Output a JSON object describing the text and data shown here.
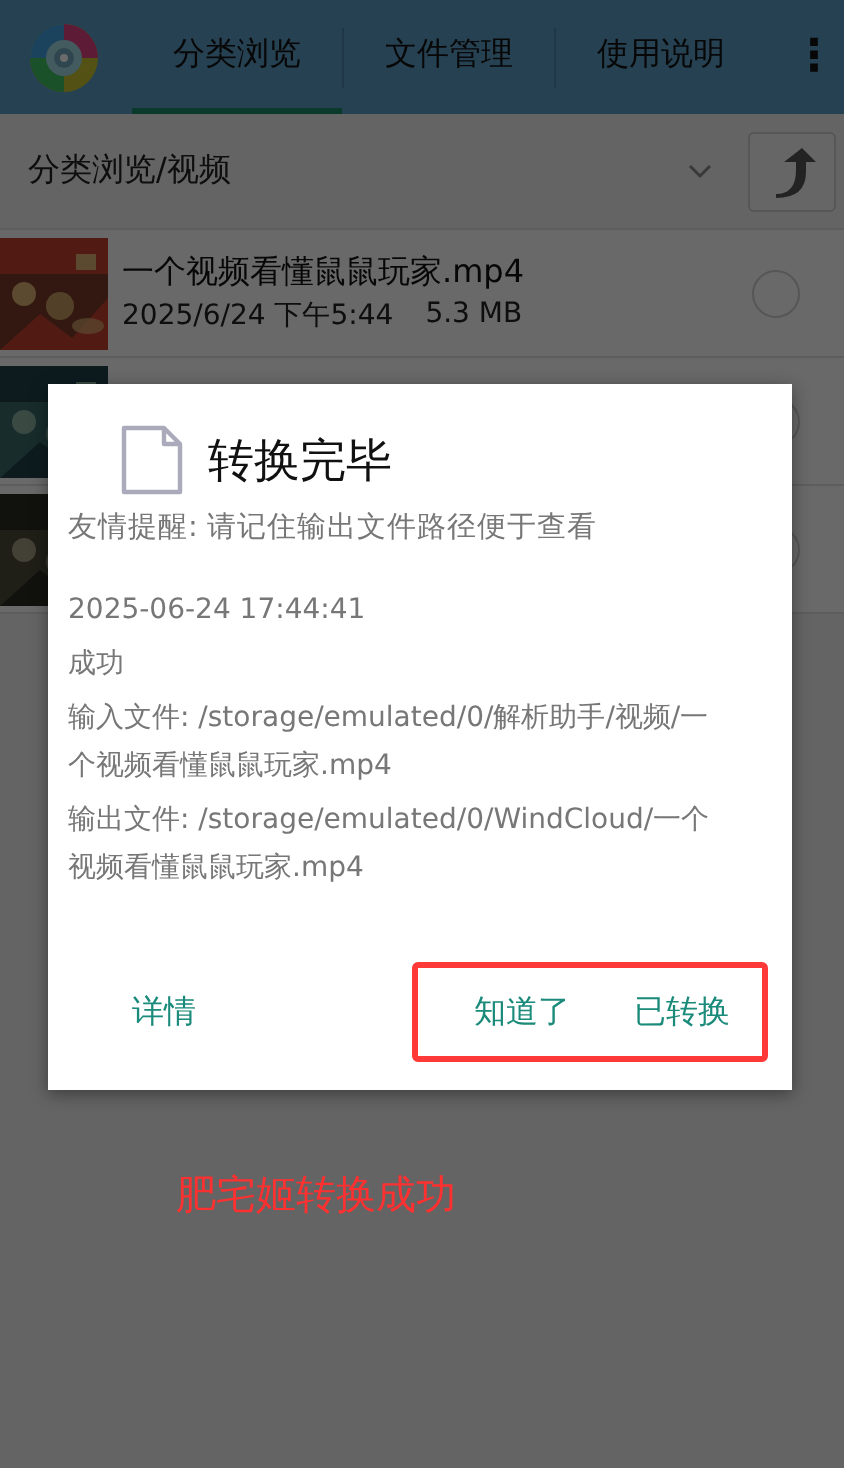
{
  "app_bar": {
    "tabs": [
      {
        "label": "分类浏览",
        "selected": true
      },
      {
        "label": "文件管理",
        "selected": false
      },
      {
        "label": "使用说明",
        "selected": false
      }
    ],
    "menu": "⋮"
  },
  "path_bar": {
    "path": "分类浏览/视频"
  },
  "files": [
    {
      "name": "一个视频看懂鼠鼠玩家.mp4",
      "date": "2025/6/24 下午5:44",
      "size": "5.3 MB",
      "selected": false
    },
    {
      "selected": false
    },
    {
      "selected": false
    }
  ],
  "dialog": {
    "title": "转换完毕",
    "hint": "友情提醒: 请记住输出文件路径便于查看",
    "lines": [
      "2025-06-24 17:44:41",
      "成功",
      "输入文件: /storage/emulated/0/解析助手/视频/一个视频看懂鼠鼠玩家.mp4",
      "输出文件: /storage/emulated/0/WindCloud/一个视频看懂鼠鼠玩家.mp4"
    ],
    "buttons": [
      "详情"
    ],
    "framed_buttons": [
      "知道了",
      "已转换"
    ]
  },
  "annotation": {
    "caption": "肥宅姬转换成功"
  }
}
